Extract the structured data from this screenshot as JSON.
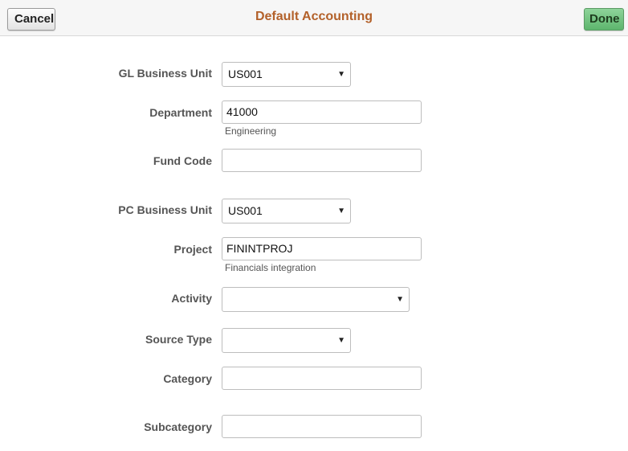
{
  "header": {
    "title": "Default Accounting",
    "cancel_label": "Cancel",
    "done_label": "Done"
  },
  "form": {
    "gl_business_unit": {
      "label": "GL Business Unit",
      "value": "US001"
    },
    "department": {
      "label": "Department",
      "value": "41000",
      "description": "Engineering"
    },
    "fund_code": {
      "label": "Fund Code",
      "value": ""
    },
    "pc_business_unit": {
      "label": "PC Business Unit",
      "value": "US001"
    },
    "project": {
      "label": "Project",
      "value": "FININTPROJ",
      "description": "Financials integration"
    },
    "activity": {
      "label": "Activity",
      "value": ""
    },
    "source_type": {
      "label": "Source Type",
      "value": ""
    },
    "category": {
      "label": "Category",
      "value": ""
    },
    "subcategory": {
      "label": "Subcategory",
      "value": ""
    }
  },
  "icons": {
    "dropdown": "chevron-down-icon"
  },
  "colors": {
    "title": "#b3612a",
    "done_button": "#6fc17d",
    "header_bg": "#f6f6f6"
  }
}
